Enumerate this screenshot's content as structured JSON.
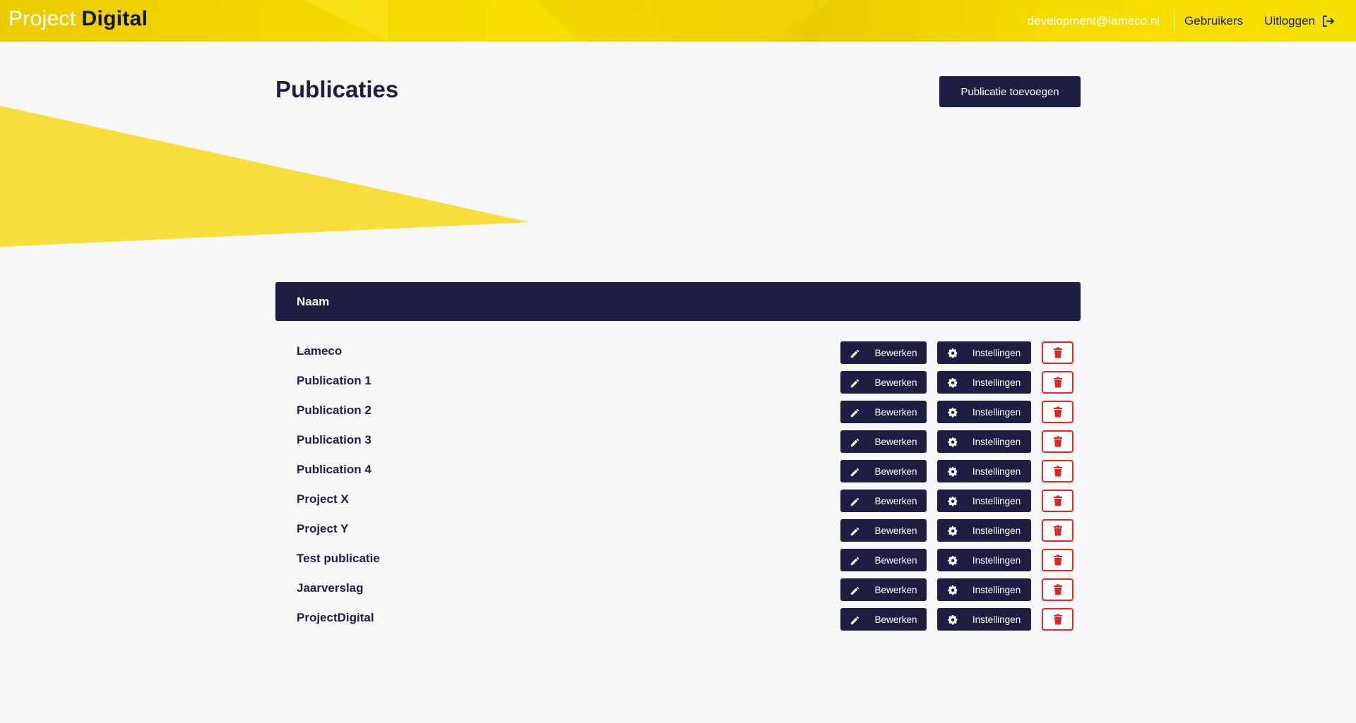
{
  "header": {
    "logo_light": "Project",
    "logo_bold": "Digital",
    "email": "development@lameco.nl",
    "users_link": "Gebruikers",
    "logout_link": "Uitloggen"
  },
  "page": {
    "title": "Publicaties",
    "add_button": "Publicatie toevoegen"
  },
  "table": {
    "column_header": "Naam",
    "edit_label": "Bewerken",
    "settings_label": "Instellingen",
    "rows": [
      {
        "name": "Lameco"
      },
      {
        "name": "Publication 1"
      },
      {
        "name": "Publication 2"
      },
      {
        "name": "Publication 3"
      },
      {
        "name": "Publication 4"
      },
      {
        "name": "Project X"
      },
      {
        "name": "Project Y"
      },
      {
        "name": "Test publicatie"
      },
      {
        "name": "Jaarverslag"
      },
      {
        "name": "ProjectDigital"
      }
    ]
  },
  "icons": {
    "edit": "pencil-icon",
    "settings": "gear-icon",
    "delete": "trash-icon",
    "logout": "logout-icon"
  },
  "colors": {
    "brand_yellow": "#f6dd00",
    "navy": "#1e1e42",
    "danger": "#e52521",
    "background": "#f7f7f7"
  }
}
